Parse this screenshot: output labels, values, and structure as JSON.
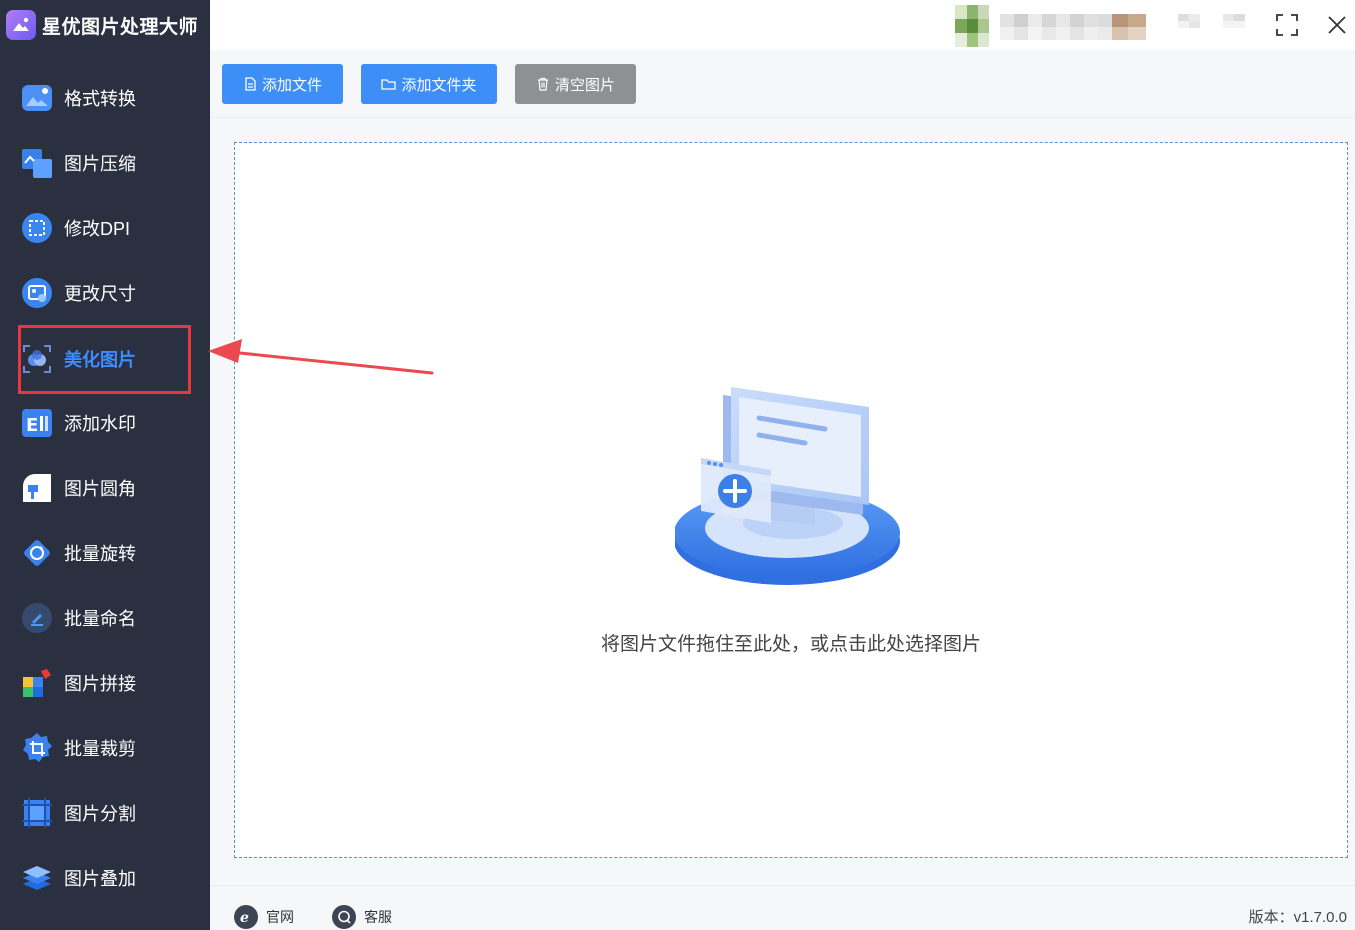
{
  "app": {
    "title": "星优图片处理大师"
  },
  "sidebar": {
    "items": [
      {
        "label": "格式转换",
        "icon": "image-convert-icon",
        "active": false
      },
      {
        "label": "图片压缩",
        "icon": "image-compress-icon",
        "active": false
      },
      {
        "label": "修改DPI",
        "icon": "dpi-icon",
        "active": false
      },
      {
        "label": "更改尺寸",
        "icon": "resize-icon",
        "active": false
      },
      {
        "label": "美化图片",
        "icon": "beautify-icon",
        "active": true
      },
      {
        "label": "添加水印",
        "icon": "watermark-icon",
        "active": false
      },
      {
        "label": "图片圆角",
        "icon": "round-corner-icon",
        "active": false
      },
      {
        "label": "批量旋转",
        "icon": "rotate-icon",
        "active": false
      },
      {
        "label": "批量命名",
        "icon": "rename-icon",
        "active": false
      },
      {
        "label": "图片拼接",
        "icon": "puzzle-icon",
        "active": false
      },
      {
        "label": "批量裁剪",
        "icon": "crop-icon",
        "active": false
      },
      {
        "label": "图片分割",
        "icon": "split-icon",
        "active": false
      },
      {
        "label": "图片叠加",
        "icon": "layers-icon",
        "active": false
      }
    ]
  },
  "toolbar": {
    "add_file": "添加文件",
    "add_folder": "添加文件夹",
    "clear_images": "清空图片"
  },
  "dropzone": {
    "hint": "将图片文件拖住至此处，或点击此处选择图片"
  },
  "footer": {
    "website": "官网",
    "support": "客服",
    "version": "版本：v1.7.0.0"
  },
  "colors": {
    "sidebar_bg": "#2b3040",
    "accent": "#3e8ef7",
    "active_text": "#3e8cff",
    "highlight": "#e8383d"
  }
}
